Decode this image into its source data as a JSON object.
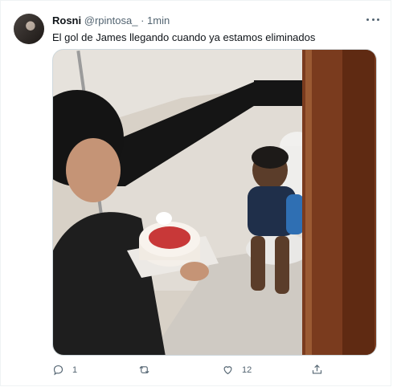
{
  "tweet": {
    "author_name": "Rosni",
    "author_handle": "@rpintosa_",
    "dot": "·",
    "time": "1min",
    "text": "El gol de James llegando cuando ya estamos eliminados"
  },
  "actions": {
    "reply_count": "1",
    "retweet_count": "",
    "like_count": "12"
  },
  "icons": {
    "more": "more-options-icon",
    "reply": "reply-icon",
    "retweet": "retweet-icon",
    "like": "heart-icon",
    "share": "share-icon"
  }
}
